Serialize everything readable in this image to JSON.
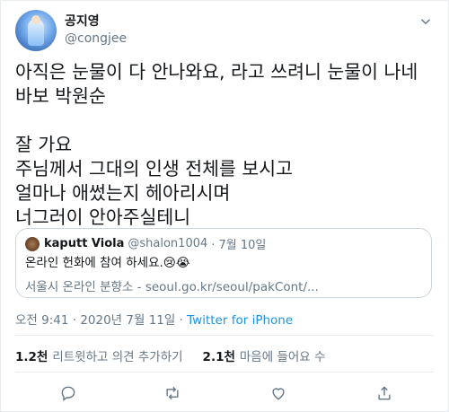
{
  "user": {
    "display_name": "공지영",
    "handle": "@congjee"
  },
  "tweet": {
    "text": "아직은 눈물이 다 안나와요, 라고 쓰려니 눈물이 나네\n바보 박원순\n\n잘 가요\n주님께서 그대의 인생 전체를 보시고\n얼마나 애썼는지 헤아리시며\n너그러이 안아주실테니"
  },
  "quote": {
    "name": "kaputt Viola",
    "handle": "@shalon1004",
    "date": "· 7월 10일",
    "text": "온라인 헌화에 참여 하세요.😢😭",
    "link": "서울시 온라인 분향소 - seoul.go.kr/seoul/pakCont/..."
  },
  "meta": {
    "time_date": "오전 9:41 · 2020년 7월 11일 · ",
    "source": "Twitter for iPhone"
  },
  "stats": {
    "retweets_count": "1.2천",
    "retweets_label": "리트윗하고 의견 추가하기",
    "likes_count": "2.1천",
    "likes_label": "마음에 들어요 수"
  },
  "icons": [
    "chevron-down-icon",
    "reply-icon",
    "retweet-icon",
    "like-icon",
    "share-icon"
  ],
  "colors": {
    "link": "#1b95e0",
    "secondary": "#657786",
    "border": "#e6ecf0"
  }
}
